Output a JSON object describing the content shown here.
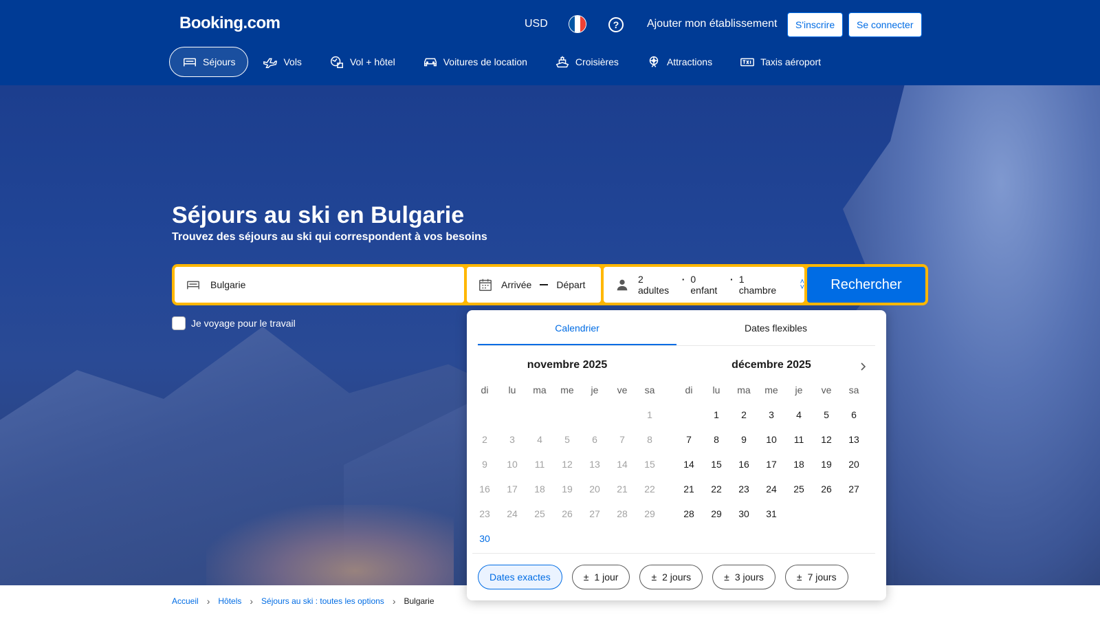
{
  "header": {
    "logo": "Booking.com",
    "currency": "USD",
    "list_property": "Ajouter mon établissement",
    "register": "S'inscrire",
    "login": "Se connecter"
  },
  "nav": {
    "items": [
      {
        "label": "Séjours",
        "icon": "bed-icon"
      },
      {
        "label": "Vols",
        "icon": "plane-icon"
      },
      {
        "label": "Vol + hôtel",
        "icon": "plane-hotel-icon"
      },
      {
        "label": "Voitures de location",
        "icon": "car-icon"
      },
      {
        "label": "Croisières",
        "icon": "ship-icon"
      },
      {
        "label": "Attractions",
        "icon": "attractions-icon"
      },
      {
        "label": "Taxis aéroport",
        "icon": "taxi-icon"
      }
    ]
  },
  "hero": {
    "title": "Séjours au ski en Bulgarie",
    "subtitle": "Trouvez des séjours au ski qui correspondent à vos besoins"
  },
  "search": {
    "destination": "Bulgarie",
    "checkin": "Arrivée",
    "checkout": "Départ",
    "adults": "2 adultes",
    "children": "0 enfant",
    "rooms": "1 chambre",
    "button": "Rechercher",
    "work_travel": "Je voyage pour le travail"
  },
  "calendar": {
    "tab_calendar": "Calendrier",
    "tab_flexible": "Dates flexibles",
    "weekdays": [
      "di",
      "lu",
      "ma",
      "me",
      "je",
      "ve",
      "sa"
    ],
    "months": [
      {
        "title": "novembre 2025",
        "first_weekday": 6,
        "days": 30,
        "past_until": 29,
        "today": 30
      },
      {
        "title": "décembre 2025",
        "first_weekday": 1,
        "days": 31,
        "past_until": 0,
        "today": 0
      }
    ],
    "chips": [
      "Dates exactes",
      "1 jour",
      "2 jours",
      "3 jours",
      "7 jours"
    ]
  },
  "breadcrumb": [
    "Accueil",
    "Hôtels",
    "Séjours au ski : toutes les options",
    "Bulgarie"
  ],
  "colors": {
    "brand_dark": "#003b95",
    "brand_blue": "#006ce4",
    "search_border": "#ffb700"
  }
}
